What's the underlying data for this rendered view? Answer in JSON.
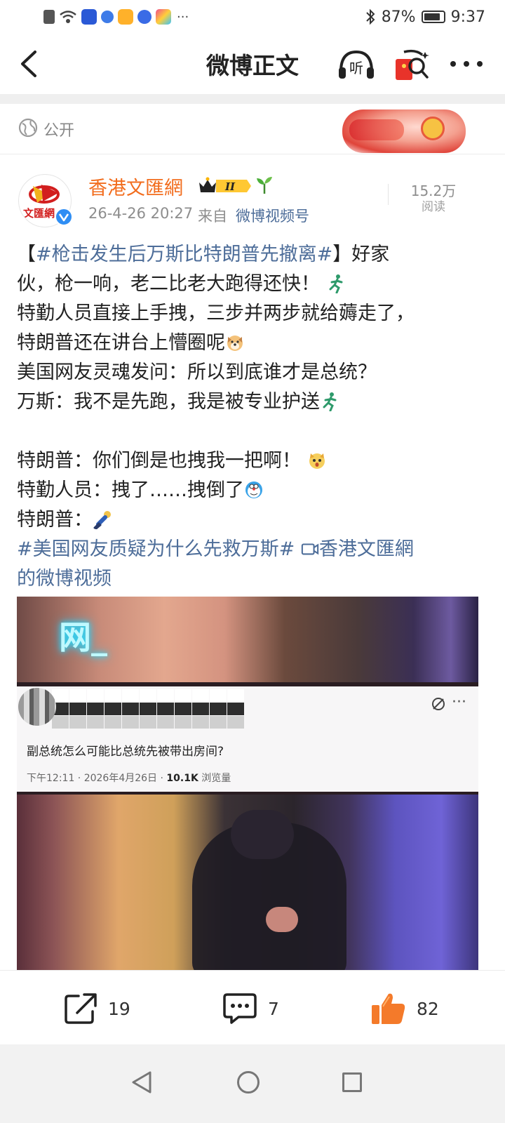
{
  "status_bar": {
    "dots": "···",
    "battery": "87%",
    "battery_level": 0.87,
    "time": "9:37",
    "icons": [
      "alert-icon",
      "wifi-icon",
      "app-icon-blue",
      "app-icon-round",
      "weibo-icon",
      "baidu-icon",
      "app-icon-colorful",
      "bluetooth-icon"
    ]
  },
  "nav": {
    "title": "微博正文",
    "listen_label": "听"
  },
  "visibility": {
    "label": "公开"
  },
  "author": {
    "name": "香港文匯網",
    "avatar_text": "文匯網",
    "badge_text": "II",
    "time": "26-4-26 20:27",
    "source_prefix": "来自",
    "source": "微博视频号",
    "reads_count": "15.2万",
    "reads_label": "阅读",
    "accent_color": "#f26d1e"
  },
  "post": {
    "open_bracket": "【",
    "headline_tag": "#枪击发生后万斯比特朗普先撤离#",
    "close_bracket": "】好家",
    "line2": "伙，枪一响，老二比老大跑得还快！",
    "line3": "特勤人员直接上手拽，三步并两步就给薅走了，",
    "line4": "特朗普还在讲台上懵圈呢",
    "line5": "美国网友灵魂发问：所以到底谁才是总统？",
    "line6": "万斯：我不是先跑，我是被专业护送",
    "line7": "特朗普：你们倒是也拽我一把啊！",
    "line8": "特勤人员：拽了……拽倒了",
    "line9": "特朗普：",
    "topic_tag": "#美国网友质疑为什么先救万斯#",
    "video_link": "香港文匯網",
    "video_link_tail": "的微博视频",
    "link_color": "#4d6d99"
  },
  "video": {
    "neon_text": "网_",
    "card_question": "副总统怎么可能比总统先被带出房间?",
    "card_meta_prefix": "下午12:11 · 2026年4月26日 · ",
    "card_meta_views": "10.1K",
    "card_meta_suffix": " 浏览量",
    "card_more": "···"
  },
  "actions": {
    "repost_count": "19",
    "comment_count": "7",
    "like_count": "82",
    "like_color": "#f47a2a"
  }
}
